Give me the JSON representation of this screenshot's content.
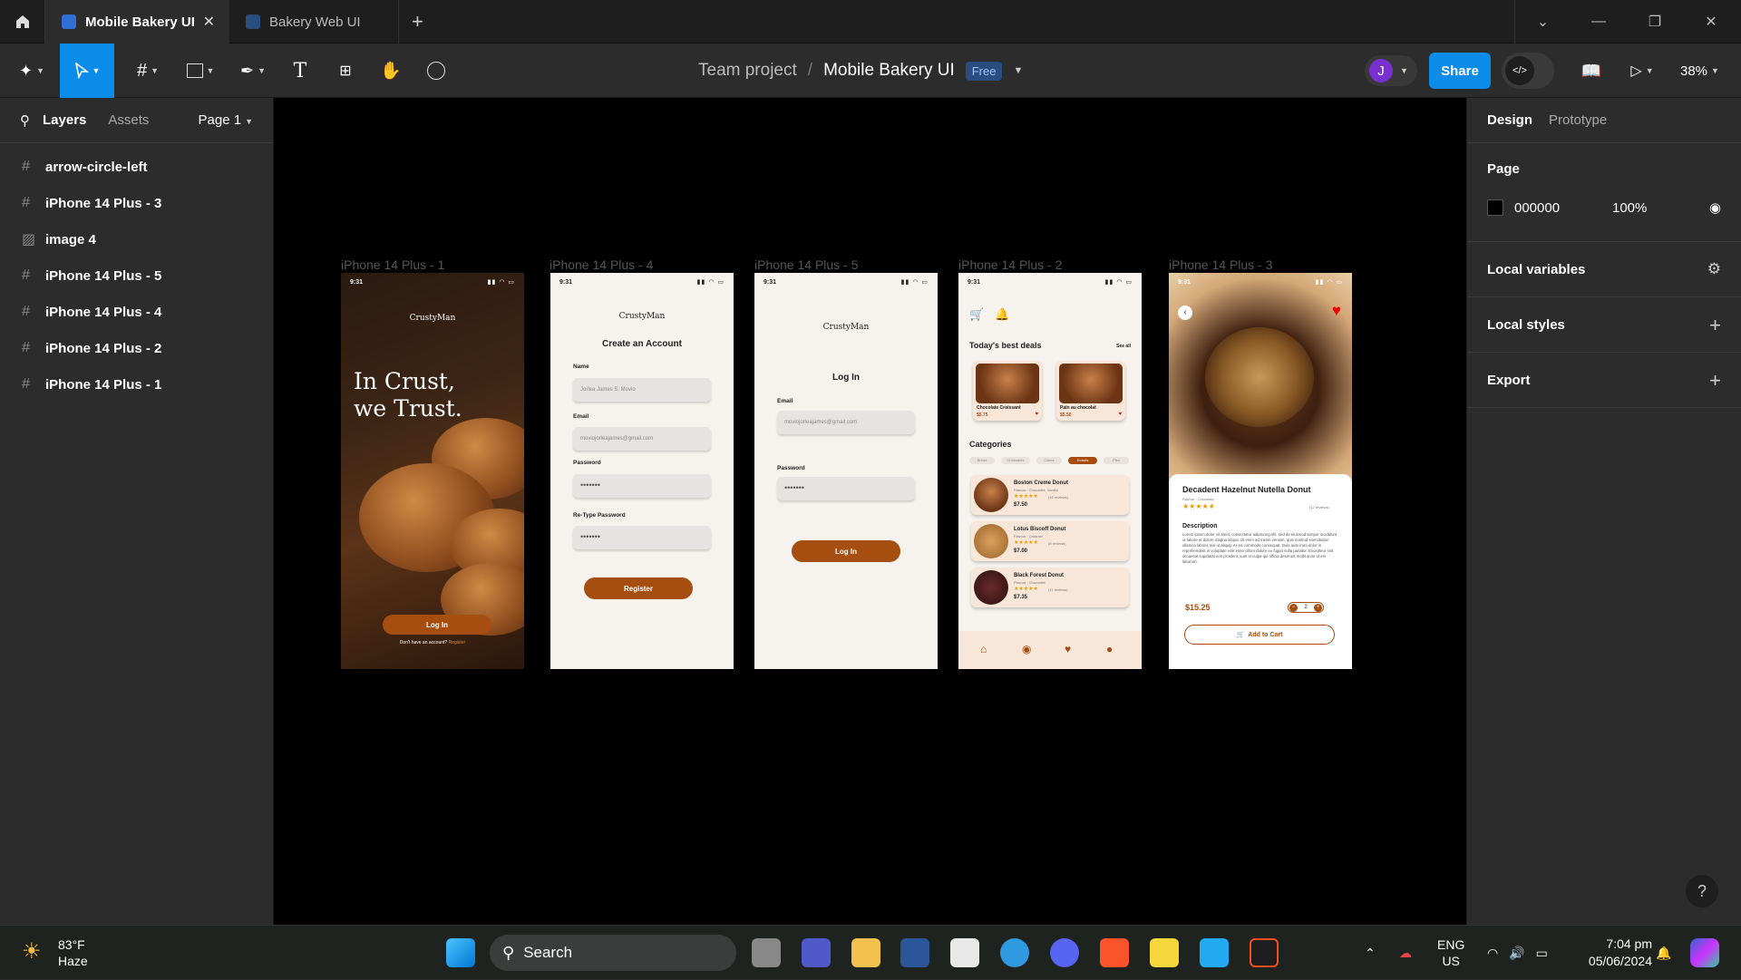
{
  "tabs": [
    {
      "label": "Mobile Bakery UI",
      "close": "✕"
    },
    {
      "label": "Bakery Web UI"
    }
  ],
  "toolbar": {
    "team": "Team project",
    "sep": "/",
    "file": "Mobile Bakery UI",
    "plan": "Free",
    "avatar": "J",
    "share": "Share",
    "zoom": "38%"
  },
  "left": {
    "tab_layers": "Layers",
    "tab_assets": "Assets",
    "page": "Page 1",
    "layers": [
      "arrow-circle-left",
      "iPhone 14 Plus - 3",
      "image 4",
      "iPhone 14 Plus - 5",
      "iPhone 14 Plus - 4",
      "iPhone 14 Plus - 2",
      "iPhone 14 Plus - 1"
    ]
  },
  "right": {
    "tab_design": "Design",
    "tab_prototype": "Prototype",
    "page_title": "Page",
    "fill_hex": "000000",
    "fill_opacity": "100%",
    "local_variables": "Local variables",
    "local_styles": "Local styles",
    "export": "Export",
    "help": "?"
  },
  "frames": {
    "labels": [
      "iPhone 14 Plus - 1",
      "iPhone 14 Plus - 4",
      "iPhone 14 Plus - 5",
      "iPhone 14 Plus - 2",
      "iPhone 14 Plus - 3"
    ],
    "time": "9:31",
    "brand": "CrustyMan",
    "f1": {
      "hero1": "In Crust,",
      "hero2": "we Trust.",
      "login": "Log In",
      "signup_q": "Don't have an account?",
      "signup": "Register"
    },
    "f4": {
      "title": "Create an Account",
      "name_label": "Name",
      "name_value": "Jorlea James S. Movio",
      "email_label": "Email",
      "email_value": "moviojorleajames@gmail.com",
      "password_label": "Password",
      "password_value": "•••••••",
      "retype_label": "Re-Type Password",
      "retype_value": "•••••••",
      "register": "Register"
    },
    "f5": {
      "title": "Log In",
      "email_label": "Email",
      "email_value": "moviojorleajames@gmail.com",
      "password_label": "Password",
      "password_value": "•••••••",
      "login": "Log In"
    },
    "f2": {
      "deals": "Today's best deals",
      "see_all": "See all",
      "deal_items": [
        {
          "name": "Chocolate Croissant",
          "price": "$5.75"
        },
        {
          "name": "Pain au chocolat",
          "price": "$5.50"
        }
      ],
      "categories": "Categories",
      "chips": [
        "Bread",
        "Croissants",
        "Cakes",
        "Donuts",
        "Pies"
      ],
      "products": [
        {
          "name": "Boston Creme Donut",
          "flavor": "Flavour : Chocolate, Vanilla",
          "price": "$7.50",
          "reviews": "(16 reviews)"
        },
        {
          "name": "Lotus Biscoff Donut",
          "flavor": "Flavour : Caramel",
          "price": "$7.00",
          "reviews": "(8 reviews)"
        },
        {
          "name": "Black Forest Donut",
          "flavor": "Flavour : Chocolate",
          "price": "$7.35",
          "reviews": "(11 reviews)"
        }
      ]
    },
    "f3": {
      "title": "Decadent Hazelnut Nutella Donut",
      "flavor": "Flavour : Chocolate",
      "reviews": "(12 reviews)",
      "desc_title": "Description",
      "desc": "Lorem ipsum dolor sit amet, consectetur adipiscing elit, sed do eiusmod tempor incididunt ut labore et dolore magna aliqua. Ut enim ad minim veniam, quis nostrud exercitation ullamco laboris nisi ut aliquip ex ea commodo consequat. Duis aute irure dolor in reprehenderit in voluptate velit esse cillum dolore eu fugiat nulla pariatur. Excepteur sint occaecat cupidatat non proident, sunt in culpa qui officia deserunt mollit anim id est laborum.",
      "price": "$15.25",
      "qty": "2",
      "add": "Add to Cart"
    }
  },
  "taskbar": {
    "temp": "83°F",
    "weather": "Haze",
    "search": "Search",
    "lang1": "ENG",
    "lang2": "US",
    "time": "7:04 pm",
    "date": "05/06/2024"
  },
  "colors": {
    "accent": "#0c8ce9",
    "bakery_brown": "#a64d10",
    "canvas": "#000000"
  }
}
